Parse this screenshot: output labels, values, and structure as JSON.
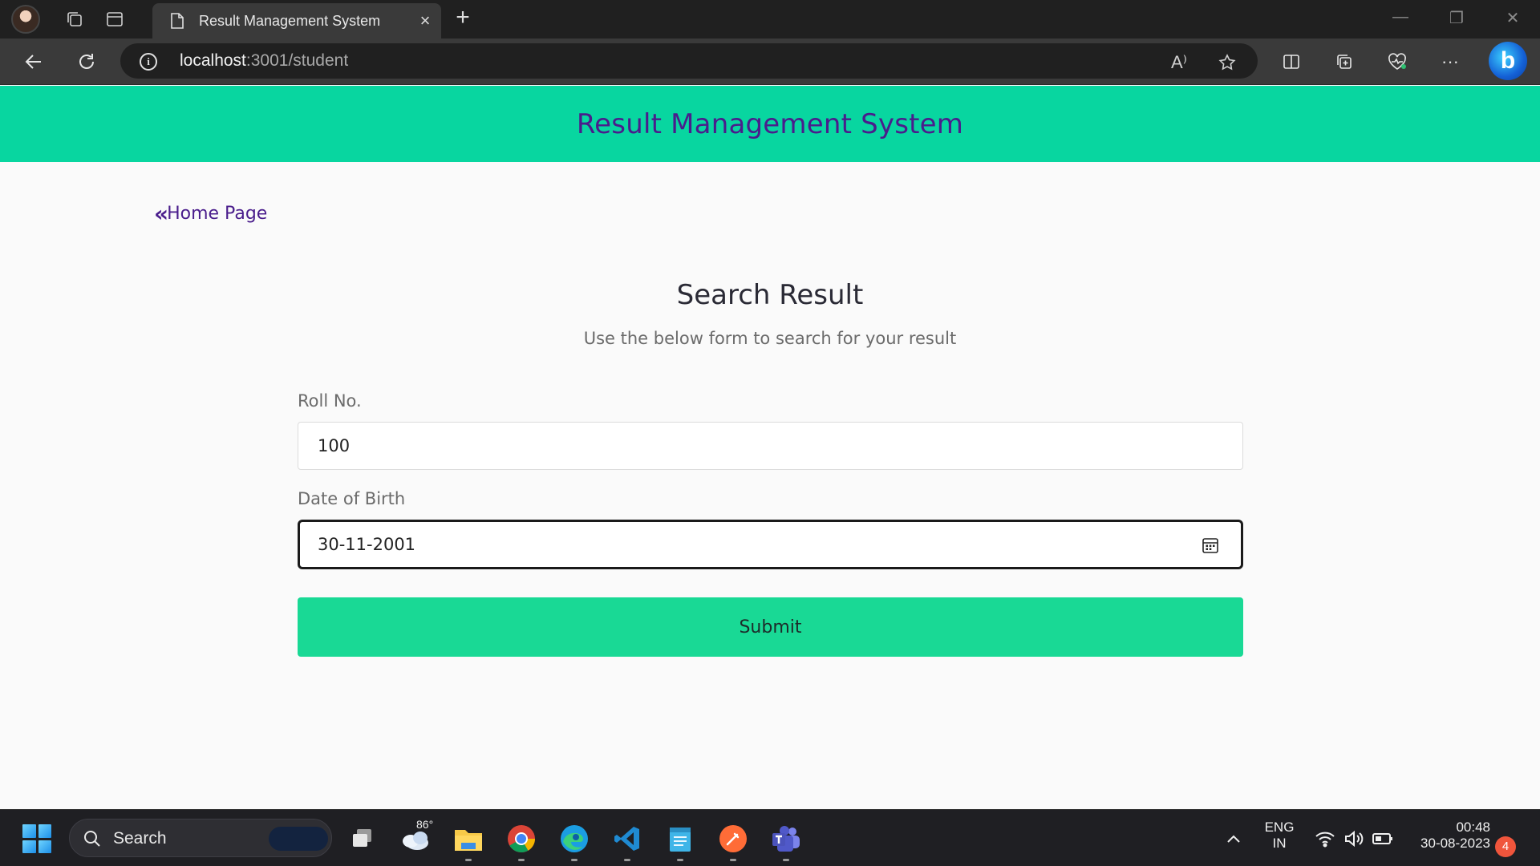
{
  "browser": {
    "tab_title": "Result Management System",
    "url_host": "localhost",
    "url_rest": ":3001/student",
    "new_tab_symbol": "+",
    "close_tab_symbol": "×",
    "read_aloud_symbol": "A⁾",
    "more_symbol": "···",
    "copilot_symbol": "b",
    "window_controls": {
      "minimize": "—",
      "restore": "❐",
      "close": "✕"
    }
  },
  "site": {
    "header_title": "Result Management System",
    "home_link_label": "Home Page",
    "home_link_icon": "«"
  },
  "form": {
    "title": "Search Result",
    "subtitle": "Use the below form to search for your result",
    "roll_label": "Roll No.",
    "roll_value": "100",
    "dob_label": "Date of Birth",
    "dob_value": "30-11-2001",
    "submit_label": "Submit"
  },
  "taskbar": {
    "search_label": "Search",
    "weather_temp": "86°",
    "lang_line1": "ENG",
    "lang_line2": "IN",
    "time": "00:48",
    "date": "30-08-2023",
    "notification_count": "4",
    "apps": [
      "task-view",
      "weather",
      "file-explorer",
      "chrome",
      "edge",
      "vscode",
      "notepad",
      "postman",
      "teams"
    ]
  },
  "colors": {
    "header_bg": "#08d6a0",
    "title_purple": "#4a1d8c",
    "submit_bg": "#19d995",
    "page_bg": "#fafafa"
  }
}
